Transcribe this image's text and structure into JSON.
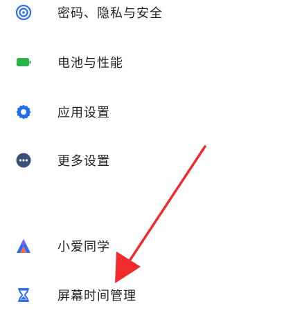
{
  "colors": {
    "icon_blue": "#2d6cf6",
    "icon_green": "#27b24a",
    "icon_teal": "#1f6cf5",
    "icon_slate": "#3a4f7a",
    "text": "#222222",
    "arrow": "#ef2b2b"
  },
  "settings": {
    "items": [
      {
        "label": "密码、隐私与安全",
        "icon": "privacy-shield-icon"
      },
      {
        "label": "电池与性能",
        "icon": "battery-icon"
      },
      {
        "label": "应用设置",
        "icon": "gear-icon"
      },
      {
        "label": "更多设置",
        "icon": "more-dots-icon"
      },
      {
        "label": "小爱同学",
        "icon": "xiaoai-assistant-icon"
      },
      {
        "label": "屏幕时间管理",
        "icon": "hourglass-icon"
      }
    ]
  }
}
